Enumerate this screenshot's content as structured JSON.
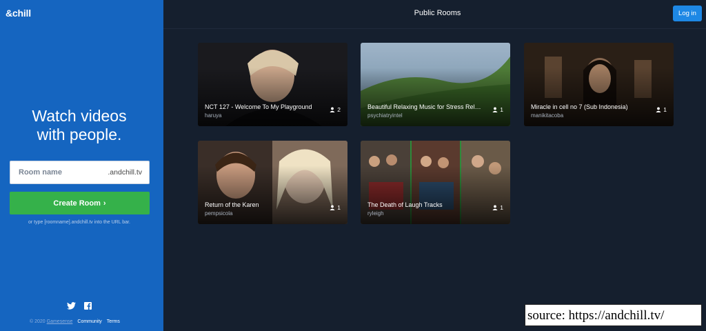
{
  "sidebar": {
    "logo": "&chill",
    "tagline_line1": "Watch videos",
    "tagline_line2": "with people.",
    "room_input": {
      "placeholder": "Room name",
      "value": ""
    },
    "room_suffix": ".andchill.tv",
    "create_button": "Create Room",
    "create_chevron": "›",
    "hint": "or type [roomname].andchill.tv into the URL bar.",
    "social_icons": [
      "twitter-icon",
      "facebook-icon"
    ],
    "footer": {
      "copyright": "© 2020",
      "company": "Gamesense",
      "community": "Community",
      "terms": "Terms"
    }
  },
  "header": {
    "title": "Public Rooms",
    "login_button": "Log in"
  },
  "rooms": [
    {
      "title": "NCT 127 - Welcome To My Playground",
      "user": "haruya",
      "count": "2"
    },
    {
      "title": "Beautiful Relaxing Music for Stress Relief",
      "user": "psychiatryintel",
      "count": "1"
    },
    {
      "title": "Miracle in cell no 7 (Sub Indonesia)",
      "user": "manikitacoba",
      "count": "1"
    },
    {
      "title": "Return of the Karen",
      "user": "pempsicola",
      "count": "1"
    },
    {
      "title": "The Death of Laugh Tracks",
      "user": "ryleigh",
      "count": "1"
    }
  ],
  "source_label": "source: https://andchill.tv/",
  "colors": {
    "sidebar": "#1565c0",
    "background": "#151f2e",
    "create_button": "#35b14a",
    "login_button": "#1e88e5"
  }
}
